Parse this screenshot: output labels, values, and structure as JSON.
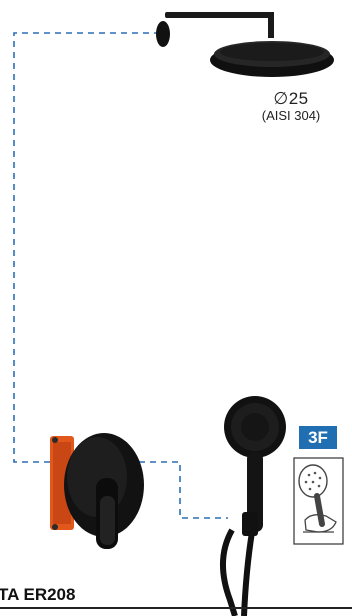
{
  "labels": {
    "diameter": "∅25",
    "material": "(AISI 304)",
    "function_badge": "3F",
    "model": "TA ER208"
  },
  "colors": {
    "dashed_line": "#2c6fb8",
    "badge": "#1f6fb2",
    "fixture": "#151515",
    "valve_body": "#e2581c"
  },
  "icons": {
    "head": "shower-head-icon",
    "valve": "mixer-valve-icon",
    "hand": "hand-shower-icon",
    "spray": "spray-mode-icon"
  }
}
